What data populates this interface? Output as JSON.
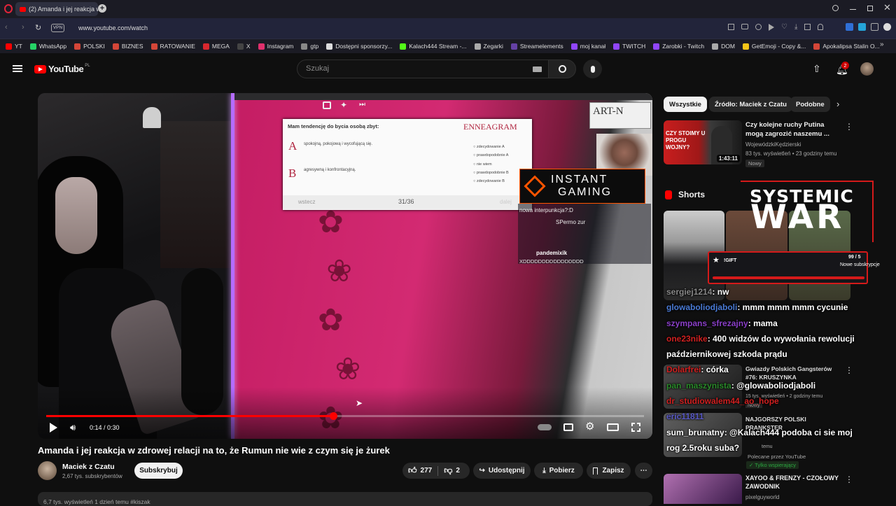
{
  "browser": {
    "tab_title": "(2) Amanda i jej reakcja w",
    "vpn_label": "VPN",
    "url": "www.youtube.com/watch",
    "bookmarks": [
      {
        "label": "YT",
        "color": "#ff0000"
      },
      {
        "label": "WhatsApp",
        "color": "#25d366"
      },
      {
        "label": "POLSKI",
        "color": "#d44638"
      },
      {
        "label": "BIZNES",
        "color": "#d44638"
      },
      {
        "label": "RATOWANIE",
        "color": "#d44638"
      },
      {
        "label": "MEGA",
        "color": "#d9272e"
      },
      {
        "label": "X",
        "color": "#444444"
      },
      {
        "label": "Instagram",
        "color": "#e1306c"
      },
      {
        "label": "gtp",
        "color": "#888888"
      },
      {
        "label": "Dostępni sponsorzy...",
        "color": "#dddddd"
      },
      {
        "label": "Kalach444 Stream -...",
        "color": "#53fc18"
      },
      {
        "label": "Zegarki",
        "color": "#aaaaaa"
      },
      {
        "label": "Streamelements",
        "color": "#6441a5"
      },
      {
        "label": "moj kanał",
        "color": "#9146ff"
      },
      {
        "label": "TWITCH",
        "color": "#9146ff"
      },
      {
        "label": "Zarobki - Twitch",
        "color": "#9146ff"
      },
      {
        "label": "DOM",
        "color": "#aaaaaa"
      },
      {
        "label": "GetEmoji - Copy &...",
        "color": "#f5c518"
      },
      {
        "label": "Apokalipsa Stalin O...",
        "color": "#d44638"
      }
    ]
  },
  "youtube": {
    "logo_text": "YouTube",
    "logo_region": "PL",
    "search_placeholder": "Szukaj",
    "notification_count": "2"
  },
  "video": {
    "overlay": {
      "quiz_question": "Mam tendencję do bycia osobą zbyt:",
      "quiz_brand": "ENNEAGRAM",
      "option_a_letter": "A",
      "option_a_text": "spokojną, pokojową i wycofującą się.",
      "option_b_letter": "B",
      "option_b_text": "agresywną i konfrontacyjną.",
      "scale": [
        "zdecydowanie A",
        "prawdopodobnie A",
        "nie wiem",
        "prawdopodobnie B",
        "zdecydowanie B"
      ],
      "back_label": "wstecz",
      "next_label": "dalej",
      "progress_label": "31/36",
      "sponsor_line1": "INSTANT",
      "sponsor_line2": "GAMING",
      "chat_lines": [
        "nowa interpunkcja?:D",
        "SPermo zur",
        "pandemixik",
        "XDDDDDDDDDDDDDDDD"
      ],
      "systemic_line1": "SYSTEMIC",
      "systemic_line2": "WAR",
      "goal_label": "!GIFT",
      "goal_count": "99 / 5",
      "goal_text": "Nowe subskrypcje",
      "art_sign": "ART-N"
    },
    "time_display": "0:14 / 0:30",
    "progress_fraction": 0.48,
    "title": "Amanda i jej reakcja w zdrowej relacji na to, że Rumun nie wie z czym się je żurek"
  },
  "channel": {
    "name": "Maciek z Czatu",
    "subscribers": "2,67 tys. subskrybentów",
    "subscribe_label": "Subskrybuj"
  },
  "actions": {
    "likes": "277",
    "dislikes": "2",
    "share_label": "Udostępnij",
    "download_label": "Pobierz",
    "save_label": "Zapisz"
  },
  "description_peek": "6,7 tys. wyświetleń  1 dzień temu  #kiszak",
  "sidebar": {
    "chips": [
      "Wszystkie",
      "Źródło: Maciek z Czatu",
      "Podobne"
    ],
    "first_video": {
      "thumb_text": "CZY STOIMY U PROGU WOJNY?",
      "duration": "1:43:11",
      "title": "Czy kolejne ruchy Putina mogą zagrozić naszemu ...",
      "channel": "WojewódzkiKędzierski",
      "meta": "83 tys. wyświetleń • 23 godziny temu",
      "badge": "Nowy"
    },
    "shorts_label": "Shorts",
    "lower_videos": [
      {
        "title": "Gwiazdy Polskich Gangsterów #76: KRUSZYNKA",
        "meta": "15 tys. wyświetleń • 2 godziny temu",
        "badge": "Nowy"
      },
      {
        "title": "NAJGORSZY POLSKI PRANKSTER",
        "meta": "temu",
        "promo": "Polecane przez YouTube",
        "members": "Tylko wspierający"
      },
      {
        "title": "XAYOO & FRENZY - CZOŁOWY ZAWODNIK",
        "channel": "pixelguyworld"
      }
    ]
  },
  "chat_overlay": [
    {
      "user": "sergiej1214",
      "user_color": "#888888",
      "message": "nw"
    },
    {
      "user": "glowaboliodjaboli",
      "user_color": "#4a7bd6",
      "message": "mmm mmm mmm cycunie"
    },
    {
      "user": "szympans_sfrezajny",
      "user_color": "#8a3fc8",
      "message": "mama"
    },
    {
      "user": "one23nike",
      "user_color": "#d02020",
      "message": "400 widzów do wywołania rewolucji"
    },
    {
      "user": "",
      "user_color": "#ffffff",
      "message": "październikowej szkoda prądu"
    },
    {
      "user": "Dolarfrei",
      "user_color": "#d02020",
      "message": "córka"
    },
    {
      "user": "pan_maszynista",
      "user_color": "#2a8a2a",
      "message": "@glowaboliodjaboli"
    },
    {
      "user": "dr_studiowalem44_ao_hope",
      "user_color": "#d02020",
      "message": ""
    },
    {
      "user": "eric11811",
      "user_color": "#5a5ac8",
      "message": ""
    },
    {
      "user": "sum_brunatny",
      "user_color": "#ffffff",
      "message": "@Kalach444 podoba ci sie moj"
    },
    {
      "user": "",
      "user_color": "#ffffff",
      "message": "rog 2.5roku suba?"
    }
  ]
}
